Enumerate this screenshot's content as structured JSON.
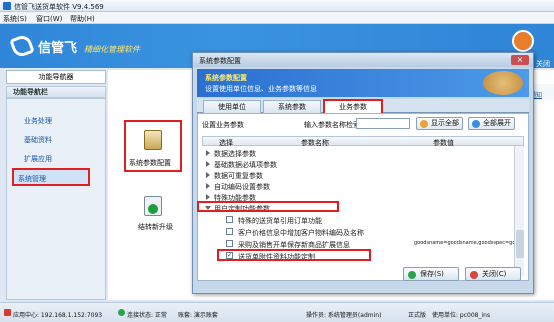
{
  "app": {
    "title": "信管飞送货单软件 V9.4.569"
  },
  "menu": [
    "系统(S)",
    "窗口(W)",
    "帮助(H)"
  ],
  "banner": {
    "logo": "信管飞",
    "slogan": "精细化管理软件",
    "top_icon_label": "关闭"
  },
  "left_tab": "功能导航器",
  "nav": {
    "header": "功能导航栏",
    "items": [
      "业务处理",
      "基础资料",
      "扩展应用",
      "系统管理"
    ],
    "active": "系统管理"
  },
  "content": {
    "hint": "通知",
    "features": [
      "系统参数配置",
      "结转新升级"
    ]
  },
  "dialog": {
    "title": "系统参数配置",
    "head_title": "系统参数配置",
    "head_sub": "设置使用单位信息、业务参数等信息",
    "tabs": [
      "使用单位",
      "系统参数",
      "业务参数"
    ],
    "active_tab": "业务参数",
    "biz_label": "设置业务参数",
    "search_label": "输入参数名称检索:",
    "search_value": "",
    "btn_show_all": "显示全部",
    "btn_expand_all": "全部展开",
    "columns": [
      "选择",
      "参数名称",
      "参数值"
    ],
    "groups": [
      "数据选择参数",
      "基础数据必填项参数",
      "数据可重复参数",
      "自动编码设置参数",
      "特殊功能参数",
      "用户定制功能参数"
    ],
    "items": [
      {
        "label": "特殊的送货单引用订单功能",
        "checked": false,
        "value": ""
      },
      {
        "label": "客户价格信息中增加客户物料编码及名称",
        "checked": false,
        "value": ""
      },
      {
        "label": "采购及销售开单保存新商品扩展信息",
        "checked": false,
        "value": "goodsname=goodsname,goodsspec=go"
      },
      {
        "label": "送货单附件资料功能定制",
        "checked": true,
        "value": ""
      }
    ],
    "btn_save": "保存(S)",
    "btn_close": "关闭(C)"
  },
  "status": {
    "server": "应用中心: 192.168.1.152:7093",
    "conn": "连接状态: 正常",
    "account": "账套: 演示账套",
    "operator": "操作员: 系统管理员(admin)",
    "edition": "正式版",
    "unit": "使用单位: pc008_ins"
  },
  "colors": {
    "accent": "#2f86d8",
    "highlight": "#e02020",
    "slogan": "#fde86a"
  }
}
